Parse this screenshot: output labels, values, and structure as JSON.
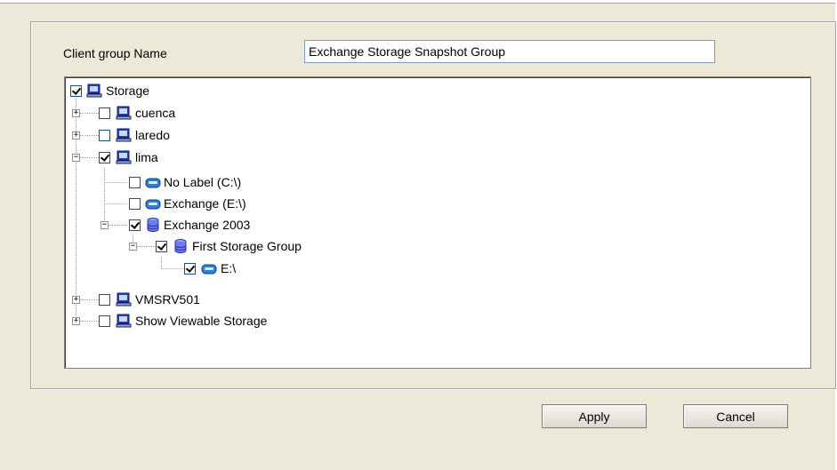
{
  "form": {
    "client_group_label": "Client group Name",
    "client_group_value": "Exchange Storage Snapshot Group"
  },
  "tree": {
    "items": [
      {
        "label": "Storage",
        "icon": "computer-icon",
        "checked": true,
        "expander": "none"
      },
      {
        "label": "cuenca",
        "icon": "computer-icon",
        "checked": false,
        "expander": "+"
      },
      {
        "label": "laredo",
        "icon": "computer-icon",
        "checked": false,
        "expander": "+"
      },
      {
        "label": "lima",
        "icon": "computer-icon",
        "checked": true,
        "expander": "-"
      },
      {
        "label": "No Label (C:\\)",
        "icon": "drive-icon",
        "checked": false,
        "expander": "none"
      },
      {
        "label": "Exchange (E:\\)",
        "icon": "drive-icon",
        "checked": false,
        "expander": "none"
      },
      {
        "label": "Exchange 2003",
        "icon": "database-icon",
        "checked": true,
        "expander": "-"
      },
      {
        "label": "First Storage Group",
        "icon": "database-icon",
        "checked": true,
        "expander": "-"
      },
      {
        "label": "E:\\",
        "icon": "drive-icon",
        "checked": true,
        "expander": "none"
      },
      {
        "label": "VMSRV501",
        "icon": "computer-icon",
        "checked": false,
        "expander": "+"
      },
      {
        "label": "Show Viewable Storage",
        "icon": "computer-icon",
        "checked": false,
        "expander": "+"
      }
    ]
  },
  "buttons": {
    "apply": "Apply",
    "cancel": "Cancel"
  },
  "colors": {
    "window_bg": "#ece9d8",
    "checkbox_border": "#1c5180",
    "computer_blue": "#2a3fbf",
    "drive_blue": "#2f7fd6"
  }
}
